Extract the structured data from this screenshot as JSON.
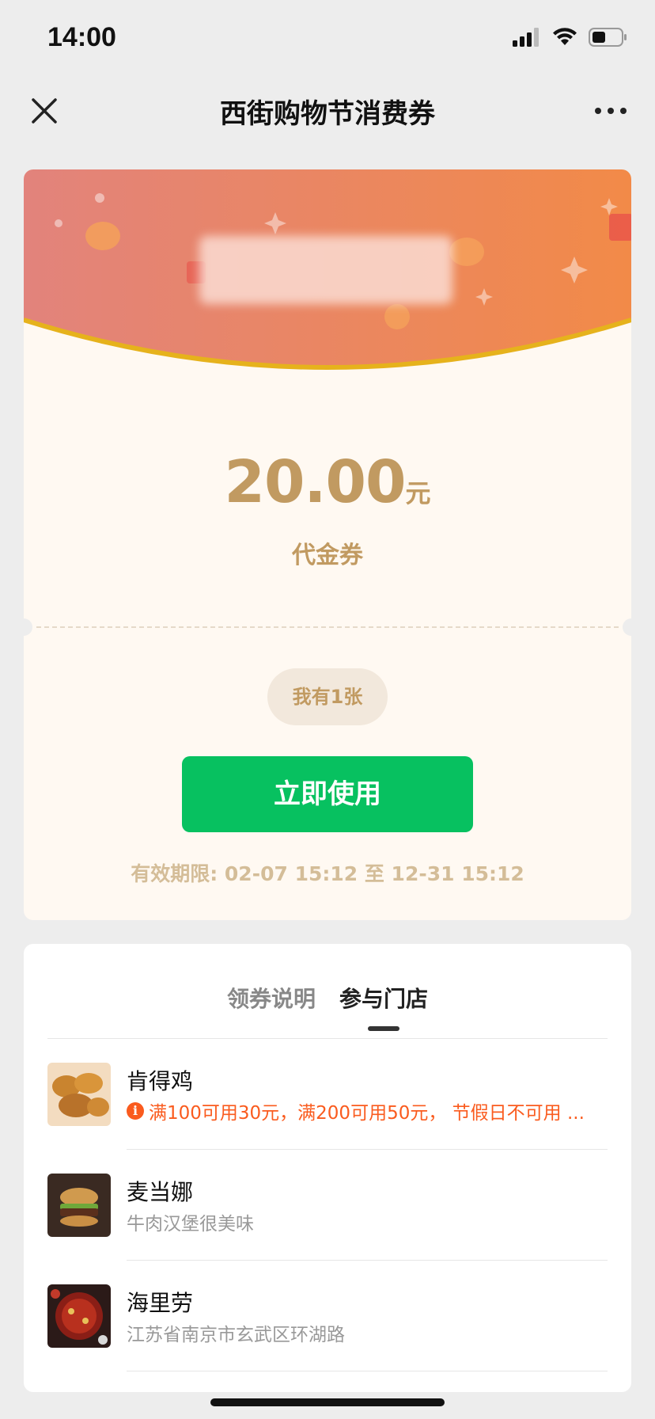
{
  "status_bar": {
    "time": "14:00"
  },
  "nav": {
    "title": "西街购物节消费券"
  },
  "coupon": {
    "amount": "20.00",
    "unit": "元",
    "type": "代金券",
    "count_label": "我有1张",
    "use_button": "立即使用",
    "validity": "有效期限: 02-07 15:12 至 12-31 15:12"
  },
  "tabs": [
    {
      "label": "领券说明",
      "active": false
    },
    {
      "label": "参与门店",
      "active": true
    }
  ],
  "stores": [
    {
      "name": "肯得鸡",
      "desc": "满100可用30元，满200可用50元， 节假日不可用 ...",
      "promo": true,
      "thumb_icon": "fried-chicken-thumbnail"
    },
    {
      "name": "麦当娜",
      "desc": "牛肉汉堡很美味",
      "promo": false,
      "thumb_icon": "burger-thumbnail"
    },
    {
      "name": "海里劳",
      "desc": "江苏省南京市玄武区环湖路",
      "promo": false,
      "thumb_icon": "hotpot-thumbnail"
    }
  ],
  "colors": {
    "accent_green": "#07c160",
    "gold_text": "#c19a61",
    "promo_orange": "#fa5b1e",
    "banner_start": "#e2837c",
    "banner_end": "#f28a48"
  }
}
